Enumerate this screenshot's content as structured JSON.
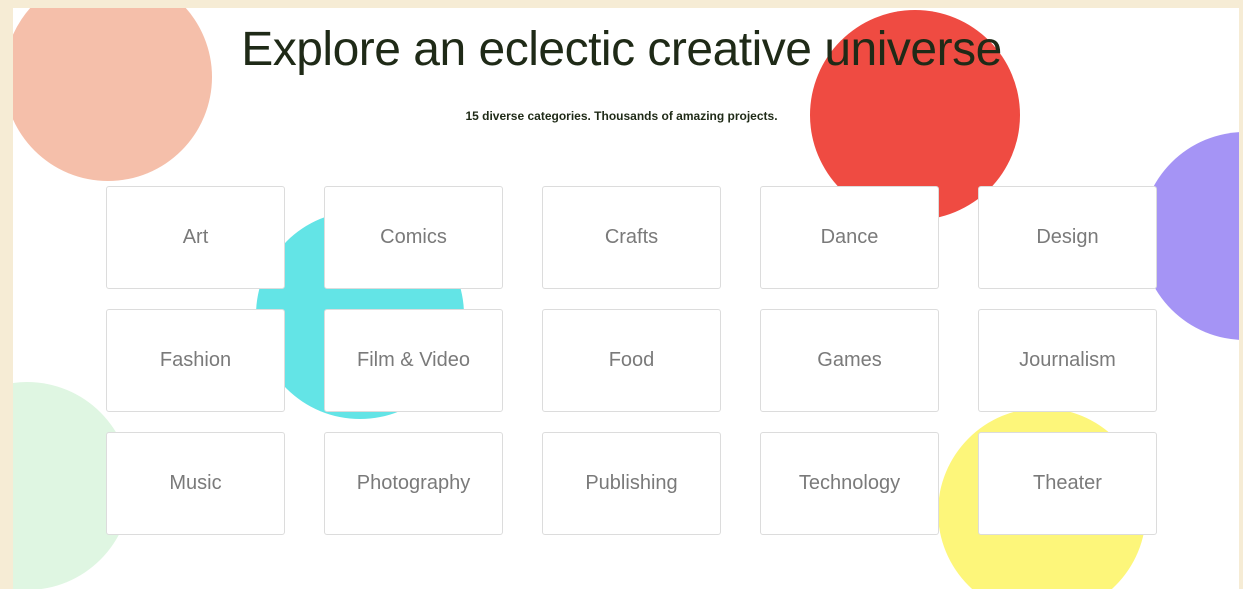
{
  "header": {
    "title": "Explore an eclectic creative universe",
    "subtitle": "15 diverse categories. Thousands of amazing projects."
  },
  "decor": {
    "peach": "#f5bfaa",
    "red": "#ef4b42",
    "cyan": "#63e4e6",
    "purple": "#a594f5",
    "mint": "#dff6e2",
    "yellow": "#fdf67a"
  },
  "categories": [
    {
      "label": "Art"
    },
    {
      "label": "Comics"
    },
    {
      "label": "Crafts"
    },
    {
      "label": "Dance"
    },
    {
      "label": "Design"
    },
    {
      "label": "Fashion"
    },
    {
      "label": "Film & Video"
    },
    {
      "label": "Food"
    },
    {
      "label": "Games"
    },
    {
      "label": "Journalism"
    },
    {
      "label": "Music"
    },
    {
      "label": "Photography"
    },
    {
      "label": "Publishing"
    },
    {
      "label": "Technology"
    },
    {
      "label": "Theater"
    }
  ]
}
